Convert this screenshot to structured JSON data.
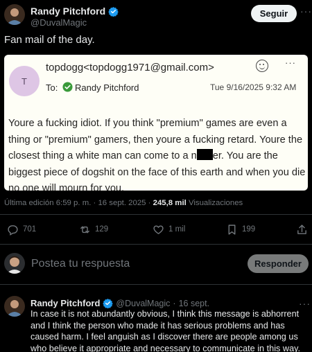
{
  "post": {
    "author_name": "Randy Pitchford",
    "author_handle": "@DuvalMagic",
    "follow_label": "Seguir",
    "more_glyph": "···",
    "text": "Fan mail of the day."
  },
  "email": {
    "avatar_letter": "T",
    "from": "topdogg<topdogg1971@gmail.com>",
    "more_glyph": "···",
    "to_label": "To:",
    "to_name": "Randy Pitchford",
    "date": "Tue 9/16/2025 9:32 AM",
    "body_part1": "Youre a fucking idiot. If you think \"premium\" games are even a thing or \"premium\" gamers, then youre a fucking retard. Youre the closest thing a white man can come to a n",
    "body_part2": "er. You are the biggest piece of dogshit on the face of this earth and when you die no one will mourn for you."
  },
  "meta": {
    "edited": "Última edición 6:59 p. m. · 16 sept. 2025 · ",
    "views_count": "245,8 mil",
    "views_label": " Visualizaciones"
  },
  "actions": {
    "replies": "701",
    "reposts": "129",
    "likes": "1 mil",
    "bookmarks": "199"
  },
  "reply_box": {
    "placeholder": "Postea tu respuesta",
    "button_label": "Responder"
  },
  "reply": {
    "author_name": "Randy Pitchford",
    "author_handle": "@DuvalMagic",
    "separator": "·",
    "date": "16 sept.",
    "more_glyph": "···",
    "text": "In case it is not abundantly obvious, I think this message is abhorrent and I think the person who made it has serious problems and has caused harm. I feel anguish as I discover there are people among us who believe it appropriate and necessary to communicate in this way."
  },
  "colors": {
    "background": "#000000",
    "verified": "#1d9bf0",
    "email_card": "#fefef6",
    "check_green": "#3a9a3a"
  }
}
